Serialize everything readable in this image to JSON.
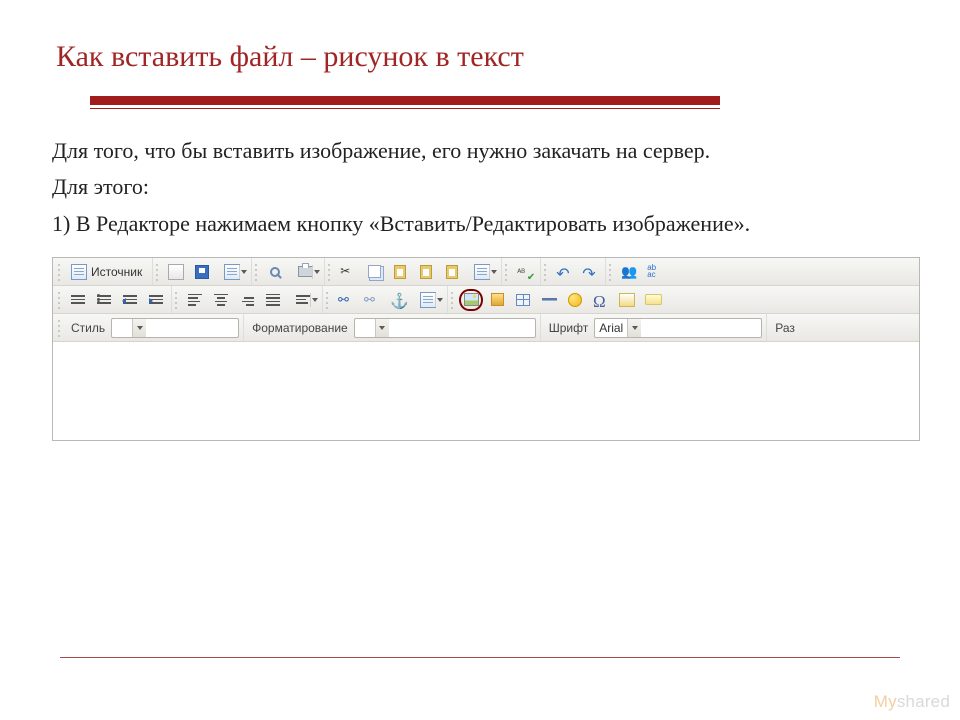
{
  "title": "Как вставить файл – рисунок в текст",
  "paragraphs": {
    "p1": "Для того, что бы вставить изображение, его нужно закачать на сервер.",
    "p2": "Для этого:",
    "p3": "1) В Редакторе нажимаем кнопку «Вставить/Редактировать изображение»."
  },
  "editor": {
    "source_label": "Источник",
    "row3": {
      "style_label": "Стиль",
      "style_value": "",
      "format_label": "Форматирование",
      "format_value": "",
      "font_label": "Шрифт",
      "font_value": "Arial",
      "size_label": "Раз"
    }
  },
  "watermark": {
    "brand_a": "My",
    "brand_b": "shared"
  }
}
